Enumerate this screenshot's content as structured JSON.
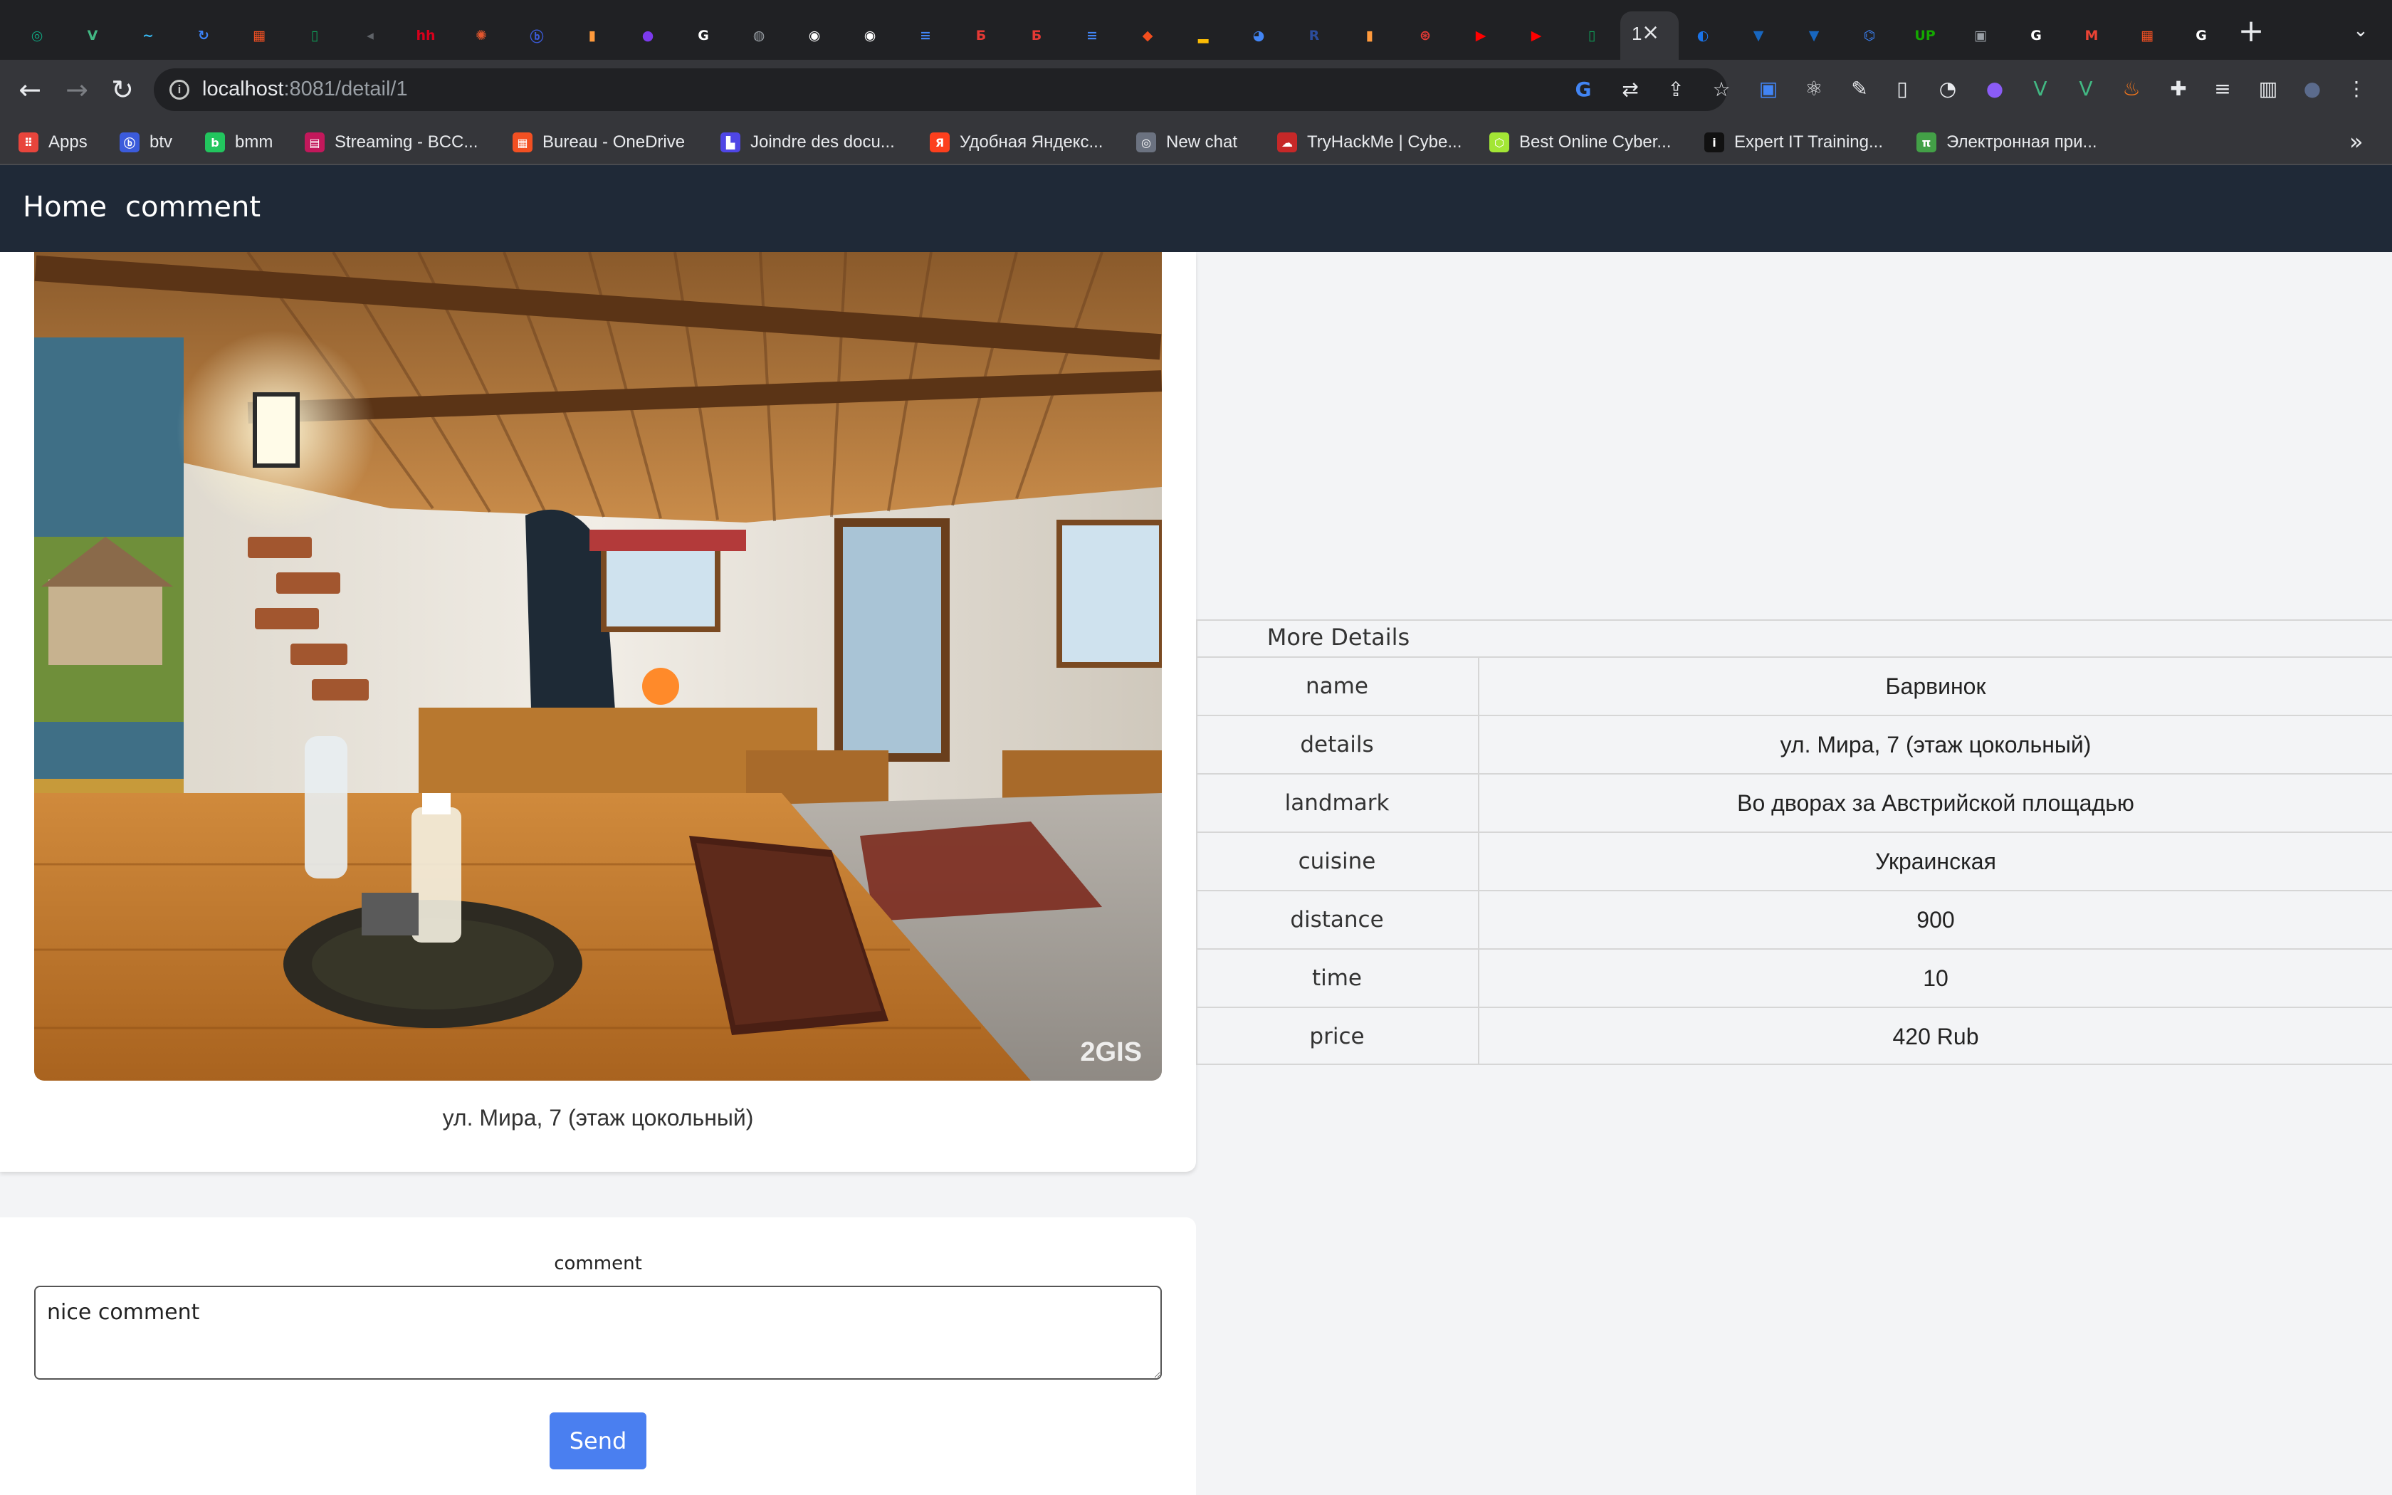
{
  "browser": {
    "active_tab_label": "1",
    "url_host": "localhost",
    "url_rest": ":8081/detail/1",
    "tabs": [
      {
        "icon": "chatgpt-icon",
        "glyph": "◎",
        "color": "#10a37f"
      },
      {
        "icon": "vue-icon",
        "glyph": "V",
        "color": "#42b883"
      },
      {
        "icon": "tailwind-icon",
        "glyph": "~",
        "color": "#38bdf8"
      },
      {
        "icon": "refresh-app-icon",
        "glyph": "↻",
        "color": "#3b82f6"
      },
      {
        "icon": "microsoft-icon",
        "glyph": "▦",
        "color": "#f25022"
      },
      {
        "icon": "sheets-icon",
        "glyph": "▯",
        "color": "#0f9d58"
      },
      {
        "icon": "audio-tab-icon",
        "glyph": "◂",
        "color": "#5f6368"
      },
      {
        "icon": "hh-icon",
        "glyph": "hh",
        "color": "#d6001c"
      },
      {
        "icon": "app-icon",
        "glyph": "✺",
        "color": "#e4572e"
      },
      {
        "icon": "btv-icon",
        "glyph": "ⓑ",
        "color": "#3b5bdb"
      },
      {
        "icon": "trello-icon",
        "glyph": "▮",
        "color": "#ff9a3c"
      },
      {
        "icon": "figma-dots-icon",
        "glyph": "●",
        "color": "#7c3aed"
      },
      {
        "icon": "google-icon",
        "glyph": "G",
        "color": "#ffffff"
      },
      {
        "icon": "globe-icon",
        "glyph": "◍",
        "color": "#9aa0a6"
      },
      {
        "icon": "github-icon",
        "glyph": "◉",
        "color": "#ffffff"
      },
      {
        "icon": "github-icon",
        "glyph": "◉",
        "color": "#ffffff"
      },
      {
        "icon": "docs-icon",
        "glyph": "≡",
        "color": "#4285f4"
      },
      {
        "icon": "b-red-icon",
        "glyph": "Б",
        "color": "#e53935"
      },
      {
        "icon": "b-red-icon",
        "glyph": "Б",
        "color": "#e53935"
      },
      {
        "icon": "docs-icon",
        "glyph": "≡",
        "color": "#4285f4"
      },
      {
        "icon": "figma-icon",
        "glyph": "◆",
        "color": "#f24e1e"
      },
      {
        "icon": "analytics-icon",
        "glyph": "▂",
        "color": "#fbbc04"
      },
      {
        "icon": "chrome-icon",
        "glyph": "◕",
        "color": "#4285f4"
      },
      {
        "icon": "r-icon",
        "glyph": "R",
        "color": "#2b4c9b"
      },
      {
        "icon": "trello-icon",
        "glyph": "▮",
        "color": "#ff9a3c"
      },
      {
        "icon": "app-red-icon",
        "glyph": "⊛",
        "color": "#e53935"
      },
      {
        "icon": "youtube-icon",
        "glyph": "▶",
        "color": "#ff0000"
      },
      {
        "icon": "youtube-icon",
        "glyph": "▶",
        "color": "#ff0000"
      },
      {
        "icon": "sheets-icon",
        "glyph": "▯",
        "color": "#0f9d58"
      },
      {
        "icon": "active-tab-icon",
        "glyph": "",
        "color": "#35363a"
      },
      {
        "icon": "edge-icon",
        "glyph": "◐",
        "color": "#1a73e8"
      },
      {
        "icon": "vuetify-icon",
        "glyph": "▼",
        "color": "#1867c0"
      },
      {
        "icon": "vuetify-icon",
        "glyph": "▼",
        "color": "#1867c0"
      },
      {
        "icon": "shield-icon",
        "glyph": "⌬",
        "color": "#3b82f6"
      },
      {
        "icon": "upwork-icon",
        "glyph": "UP",
        "color": "#14a800"
      },
      {
        "icon": "image-icon",
        "glyph": "▣",
        "color": "#9aa0a6"
      },
      {
        "icon": "google-icon",
        "glyph": "G",
        "color": "#ffffff"
      },
      {
        "icon": "gmail-icon",
        "glyph": "M",
        "color": "#ea4335"
      },
      {
        "icon": "microsoft-icon",
        "glyph": "▦",
        "color": "#f25022"
      },
      {
        "icon": "google-icon",
        "glyph": "G",
        "color": "#ffffff"
      }
    ],
    "bookmarks": [
      {
        "label": "Apps",
        "icon": "apps-grid-icon",
        "glyph": "⠿",
        "color": "#e8453c"
      },
      {
        "label": "btv",
        "icon": "btv-icon",
        "glyph": "ⓑ",
        "color": "#3b5bdb"
      },
      {
        "label": "bmm",
        "icon": "bmm-icon",
        "glyph": "b",
        "color": "#22c55e"
      },
      {
        "label": "Streaming - BCC...",
        "icon": "bcc-icon",
        "glyph": "▤",
        "color": "#c2185b"
      },
      {
        "label": "Bureau - OneDrive",
        "icon": "microsoft-icon",
        "glyph": "▦",
        "color": "#f25022"
      },
      {
        "label": "Joindre des docu...",
        "icon": "document-icon",
        "glyph": "▙",
        "color": "#4f46e5"
      },
      {
        "label": "Удобная Яндекс...",
        "icon": "yandex-icon",
        "glyph": "Я",
        "color": "#fc3f1d"
      },
      {
        "label": "New chat",
        "icon": "chatgpt-icon",
        "glyph": "◎",
        "color": "#6b7280"
      },
      {
        "label": "TryHackMe | Cybe...",
        "icon": "cloud-icon",
        "glyph": "☁",
        "color": "#c62828"
      },
      {
        "label": "Best Online Cyber...",
        "icon": "cube-icon",
        "glyph": "⬡",
        "color": "#a3e635"
      },
      {
        "label": "Expert IT Training...",
        "icon": "ine-icon",
        "glyph": "i",
        "color": "#111111"
      },
      {
        "label": "Электронная при...",
        "icon": "pi-icon",
        "glyph": "π",
        "color": "#43a047"
      }
    ],
    "bookmarks_more": "»"
  },
  "nav": {
    "home": "Home",
    "comment": "comment"
  },
  "restaurant": {
    "caption": "ул. Мира, 7 (этаж цокольный)",
    "photo_watermark": "2GIS"
  },
  "details": {
    "title": "More Details",
    "rows": [
      {
        "key": "name",
        "value": "Барвинок"
      },
      {
        "key": "details",
        "value": "ул. Мира, 7 (этаж цокольный)"
      },
      {
        "key": "landmark",
        "value": "Во дворах за Австрийской площадью"
      },
      {
        "key": "cuisine",
        "value": "Украинская"
      },
      {
        "key": "distance",
        "value": "900"
      },
      {
        "key": "time",
        "value": "10"
      },
      {
        "key": "price",
        "value": "420 Rub"
      }
    ]
  },
  "comment_form": {
    "label": "comment",
    "value": "nice comment",
    "send": "Send"
  }
}
